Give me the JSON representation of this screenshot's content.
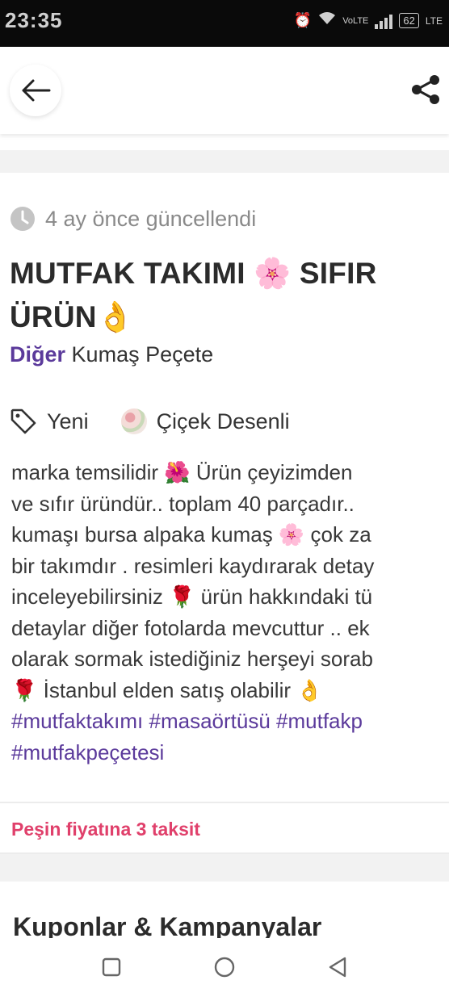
{
  "status_bar": {
    "time": "23:35",
    "battery": "62",
    "network": "LTE"
  },
  "header": {
    "back_icon": "arrow-left-icon",
    "share_icon": "share-icon"
  },
  "listing": {
    "updated": "4 ay önce güncellendi",
    "title_line1": "MUTFAK TAKIMI 🌸 SIFIR",
    "title_line2": "ÜRÜN👌",
    "category_main": "Diğer",
    "category_sub": "Kumaş Peçete",
    "condition": "Yeni",
    "pattern": "Çiçek Desenli",
    "description_lines": [
      "marka temsilidir 🌺 Ürün çeyizimden",
      "ve sıfır üründür.. toplam 40 parçadır..",
      "kumaşı bursa alpaka kumaş 🌸 çok za",
      "bir takımdır . resimleri kaydırarak detay",
      "inceleyebilirsiniz 🌹 ürün hakkındaki tü",
      "detaylar diğer fotolarda mevcuttur .. ek",
      "olarak sormak istediğiniz herşeyi sorab",
      "🌹 İstanbul elden satış olabilir 👌"
    ],
    "hashtag_line1": "#mutfaktakımı #masaörtüsü #mutfakp",
    "hashtag_line2": "#mutfakpeçetesi",
    "installment": "Peşin fiyatına 3 taksit",
    "section_title": "Kuponlar & Kampanyalar"
  },
  "colors": {
    "accent_purple": "#5b3a9b",
    "installment_pink": "#e0406b",
    "muted_gray": "#8a8a8a"
  }
}
